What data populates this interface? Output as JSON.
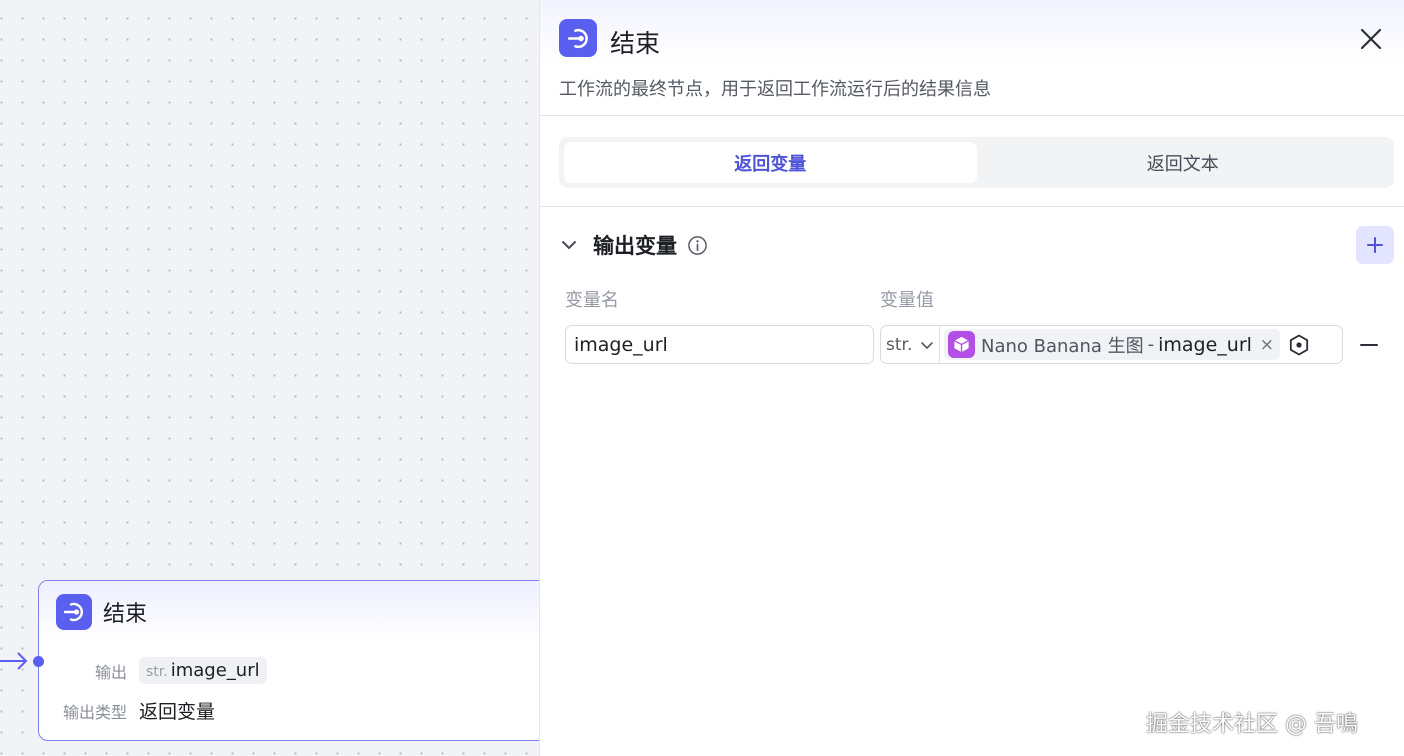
{
  "canvas": {
    "node": {
      "title": "结束",
      "output_label": "输出",
      "output_type": "str.",
      "output_name": "image_url",
      "output_mode_label": "输出类型",
      "output_mode_value": "返回变量"
    }
  },
  "panel": {
    "title": "结束",
    "description": "工作流的最终节点，用于返回工作流运行后的结果信息",
    "tabs": [
      {
        "label": "返回变量",
        "active": true
      },
      {
        "label": "返回文本",
        "active": false
      }
    ],
    "section": {
      "title": "输出变量",
      "col_name": "变量名",
      "col_value": "变量值",
      "rows": [
        {
          "name": "image_url",
          "type": "str.",
          "ref_source": "Nano Banana 生图",
          "ref_separator": "-",
          "ref_var": "image_url",
          "ref_remove": "×"
        }
      ]
    }
  },
  "watermark": "掘金技术社区 @ 吾鳴",
  "colors": {
    "accent": "#5b5ff0",
    "plugin": "#b44fe6",
    "tab_active_text": "#4f53d8",
    "add_btn_bg": "#e3e4ff"
  },
  "icons": [
    "end-node-icon",
    "close-icon",
    "chevron-down-icon",
    "info-icon",
    "plus-icon",
    "cube-plugin-icon",
    "variable-picker-icon",
    "minus-icon",
    "arrow-right-icon"
  ]
}
